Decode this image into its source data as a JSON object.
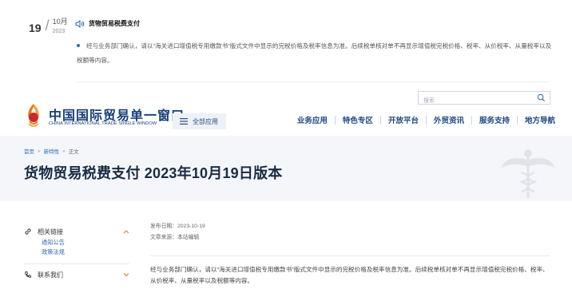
{
  "notice": {
    "day": "19",
    "month": "10月",
    "year": "2023",
    "title": "货物贸易税费支付",
    "body": "经与业务部门确认，请以“海关进口增值税专用缴款书”版式文件中显示的完税价格及税率信息为准。后续税单核对单不再显示增值税完税价格、税率、从价税率、从量税率以及税额等内容。"
  },
  "header": {
    "search_placeholder": "搜索",
    "logo_cn": "中国国际贸易单一窗口",
    "logo_en": "CHINA INTERNATIONAL TRADE SINGLE WINDOW",
    "all_apps": "全部应用",
    "nav": [
      "业务应用",
      "特色专区",
      "开放平台",
      "外贸资讯",
      "服务支持",
      "地方导航"
    ]
  },
  "banner": {
    "breadcrumb": [
      "首页",
      "新特性",
      "正文"
    ],
    "title": "货物贸易税费支付 2023年10月19日版本"
  },
  "sidebar": {
    "related_links": "相关链接",
    "links": [
      "通知公告",
      "政策法规"
    ],
    "contact": "联系我们"
  },
  "article": {
    "publish_date": "发布日期：2023-10-19",
    "source": "文章来源：本站编辑",
    "body": "经与业务部门确认，请以“海关进口增值税专用缴款书”版式文件中显示的完税价格及税率信息为准。后续税单核对单不再显示增值税完税价格、税率、从价税率、从量税率以及税额等内容。"
  },
  "colors": {
    "brand_blue": "#173f7a",
    "link_blue": "#2e69b3",
    "logo_orange": "#e8771c",
    "logo_red": "#c92a2a"
  }
}
